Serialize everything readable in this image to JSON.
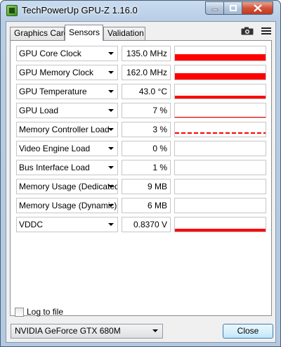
{
  "window": {
    "title": "TechPowerUp GPU-Z 1.16.0"
  },
  "tabs": [
    {
      "label": "Graphics Card",
      "active": false
    },
    {
      "label": "Sensors",
      "active": true
    },
    {
      "label": "Validation",
      "active": false
    }
  ],
  "toolbar": {
    "camera_icon": "camera-icon",
    "menu_icon": "hamburger-menu-icon"
  },
  "sensors": [
    {
      "name": "GPU Core Clock",
      "value": "135.0 MHz",
      "graph_level": 0.45,
      "graph_style": "solid"
    },
    {
      "name": "GPU Memory Clock",
      "value": "162.0 MHz",
      "graph_level": 0.45,
      "graph_style": "solid"
    },
    {
      "name": "GPU Temperature",
      "value": "43.0 °C",
      "graph_level": 0.2,
      "graph_style": "solid"
    },
    {
      "name": "GPU Load",
      "value": "7 %",
      "graph_level": 0.07,
      "graph_style": "solid"
    },
    {
      "name": "Memory Controller Load",
      "value": "3 %",
      "graph_level": 0.03,
      "graph_style": "dotted"
    },
    {
      "name": "Video Engine Load",
      "value": "0 %",
      "graph_level": 0,
      "graph_style": "none"
    },
    {
      "name": "Bus Interface Load",
      "value": "1 %",
      "graph_level": 0,
      "graph_style": "none"
    },
    {
      "name": "Memory Usage (Dedicated)",
      "value": "9 MB",
      "graph_level": 0,
      "graph_style": "none"
    },
    {
      "name": "Memory Usage (Dynamic)",
      "value": "6 MB",
      "graph_level": 0,
      "graph_style": "none"
    },
    {
      "name": "VDDC",
      "value": "0.8370 V",
      "graph_level": 0.2,
      "graph_style": "solid"
    }
  ],
  "footer": {
    "log_to_file_label": "Log to file",
    "log_to_file_checked": false,
    "gpu_selected": "NVIDIA GeForce GTX 680M",
    "close_label": "Close"
  },
  "colors": {
    "graph": "#ff0000",
    "titlebar": "#b9cfe7"
  }
}
